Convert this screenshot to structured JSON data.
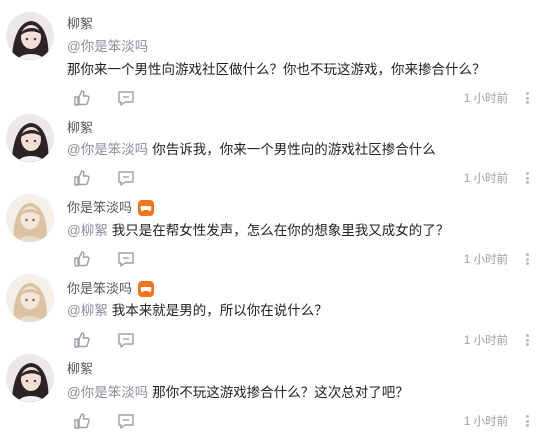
{
  "comments": [
    {
      "user": "柳絮",
      "mention": "@你是笨淡吗",
      "text": "那你来一个男性向游戏社区做什么？你也不玩这游戏，你来掺合什么？",
      "time": "1 小时前",
      "avatar": "dark-hair-avatar",
      "badge": false
    },
    {
      "user": "柳絮",
      "mention": "@你是笨淡吗",
      "text": "你告诉我，你来一个男性向的游戏社区掺合什么",
      "time": "1 小时前",
      "avatar": "dark-hair-avatar",
      "badge": false
    },
    {
      "user": "你是笨淡吗",
      "mention": "@柳絮",
      "text": "我只是在帮女性发声，怎么在你的想象里我又成女的了？",
      "time": "1 小时前",
      "avatar": "blonde-avatar",
      "badge": true
    },
    {
      "user": "你是笨淡吗",
      "mention": "@柳絮",
      "text": "我本来就是男的，所以你在说什么？",
      "time": "1 小时前",
      "avatar": "blonde-avatar",
      "badge": true
    },
    {
      "user": "柳絮",
      "mention": "@你是笨淡吗",
      "text": "那你不玩这游戏掺合什么？这次总对了吧？",
      "time": "1 小时前",
      "avatar": "dark-hair-avatar",
      "badge": false
    }
  ],
  "colors": {
    "mention": "#8a8f99",
    "time": "#9aa0a8",
    "badge": "#f0751f",
    "icon": "#9aa0a8"
  }
}
